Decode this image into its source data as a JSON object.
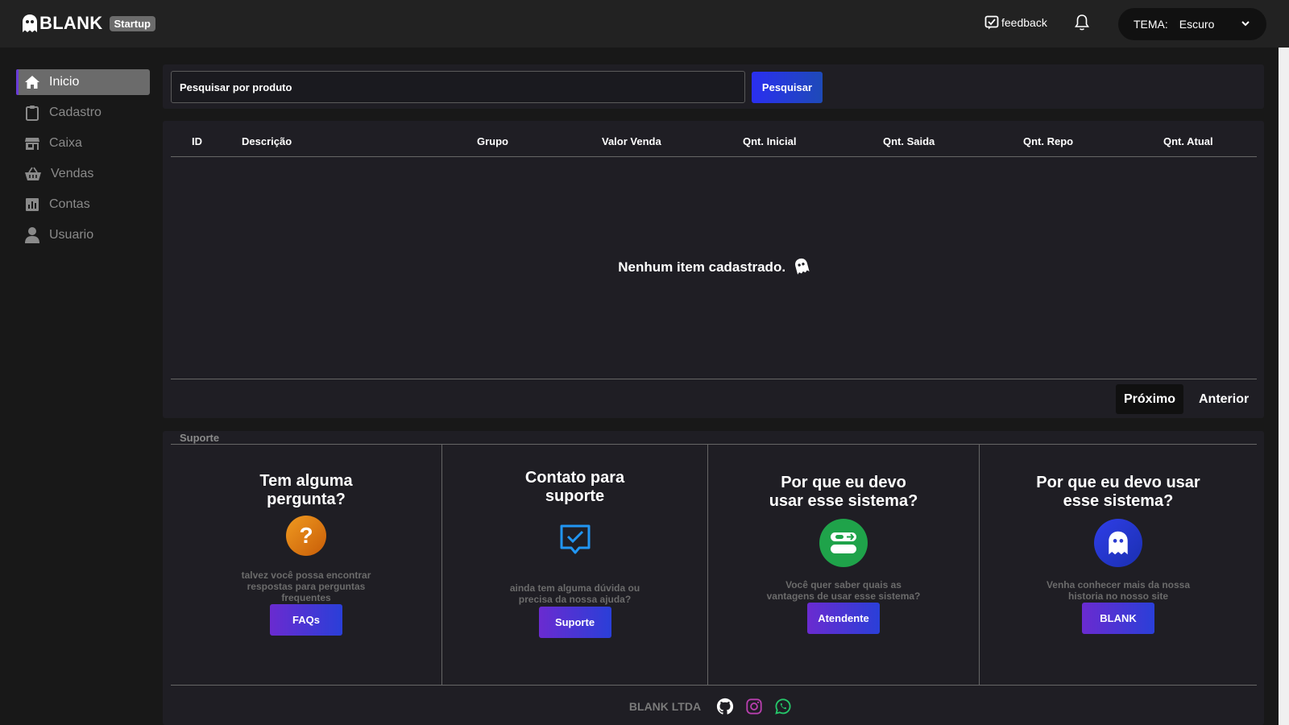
{
  "brand": {
    "name": "BLANK",
    "plan": "Startup"
  },
  "header": {
    "feedback_label": "feedback",
    "theme_label": "TEMA:",
    "theme_value": "Escuro"
  },
  "sidebar": {
    "items": [
      {
        "label": "Inicio",
        "icon": "home-icon",
        "active": true
      },
      {
        "label": "Cadastro",
        "icon": "clipboard-icon",
        "active": false
      },
      {
        "label": "Caixa",
        "icon": "store-icon",
        "active": false
      },
      {
        "label": "Vendas",
        "icon": "basket-icon",
        "active": false
      },
      {
        "label": "Contas",
        "icon": "chart-icon",
        "active": false
      },
      {
        "label": "Usuario",
        "icon": "user-icon",
        "active": false
      }
    ]
  },
  "search": {
    "placeholder": "Pesquisar por produto",
    "button_label": "Pesquisar"
  },
  "table": {
    "columns": [
      "ID",
      "Descrição",
      "Grupo",
      "Valor Venda",
      "Qnt. Inicial",
      "Qnt. Saida",
      "Qnt. Repo",
      "Qnt. Atual"
    ],
    "rows": [],
    "empty_message": "Nenhum item cadastrado.",
    "next_label": "Próximo",
    "prev_label": "Anterior"
  },
  "support": {
    "title": "Suporte",
    "cards": [
      {
        "title": "Tem alguma pergunta?",
        "icon": "question-icon",
        "description": "talvez você possa encontrar respostas para perguntas frequentes",
        "button_label": "FAQs"
      },
      {
        "title": "Contato para suporte",
        "icon": "chat-check-icon",
        "description": "ainda tem alguma dúvida ou precisa da nossa ajuda?",
        "button_label": "Suporte"
      },
      {
        "title": "Por que eu devo usar esse sistema?",
        "icon": "toggle-icon",
        "description": "Você quer saber quais as vantagens de usar esse sistema?",
        "button_label": "Atendente"
      },
      {
        "title": "Por que eu devo usar esse sistema?",
        "icon": "ghost-icon",
        "description": "Venha conhecer mais da nossa historia no nosso site",
        "button_label": "BLANK"
      }
    ]
  },
  "footer": {
    "brand": "BLANK LTDA",
    "social": [
      "github-icon",
      "instagram-icon",
      "whatsapp-icon"
    ]
  },
  "colors": {
    "background": "#181818",
    "panel": "#1f1e24",
    "accent_blue": "#2a2ff0",
    "accent_purple": "#6a2bd0",
    "faq_orange": "#e07a10",
    "support_blue": "#2196f3",
    "attendant_green": "#1fa34a"
  }
}
